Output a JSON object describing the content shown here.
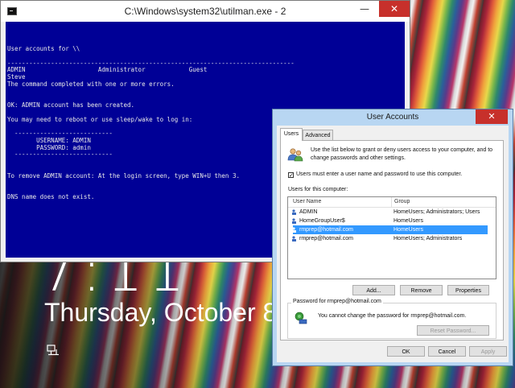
{
  "lockscreen": {
    "clock": "7:11",
    "date": "Thursday, October 8"
  },
  "console": {
    "title": "C:\\Windows\\system32\\utilman.exe - 2",
    "minimize_glyph": "—",
    "close_glyph": "✕",
    "lines": [
      "User accounts for \\\\",
      "",
      "-------------------------------------------------------------------------------",
      "ADMIN                    Administrator            Guest",
      "Steve",
      "The command completed with one or more errors.",
      "",
      "",
      "OK: ADMIN account has been created.",
      "",
      "You may need to reboot or use sleep/wake to log in:",
      "",
      "  ---------------------------",
      "        USERNAME: ADMIN",
      "        PASSWORD: admin",
      "  ---------------------------",
      "",
      "",
      "To remove ADMIN account: At the login screen, type WIN+U then 3.",
      "",
      "",
      "DNS name does not exist."
    ]
  },
  "dialog": {
    "title": "User Accounts",
    "close_glyph": "✕",
    "tabs": [
      "Users",
      "Advanced"
    ],
    "intro": "Use the list below to grant or deny users access to your computer, and to change passwords and other settings.",
    "require_password_checked": "✓",
    "require_password_label": "Users must enter a user name and password to use this computer.",
    "users_for_computer_label": "Users for this computer:",
    "columns": [
      "User Name",
      "Group"
    ],
    "users": [
      {
        "name": "ADMIN",
        "group": "HomeUsers; Administrators; Users"
      },
      {
        "name": "HomeGroupUser$",
        "group": "HomeUsers"
      },
      {
        "name": "rmprep@hotmail.com",
        "group": "HomeUsers"
      },
      {
        "name": "rmprep@hotmail.com",
        "group": "HomeUsers; Administrators"
      }
    ],
    "selected_index": 2,
    "buttons": {
      "add": "Add...",
      "remove": "Remove",
      "properties": "Properties"
    },
    "password_group_label": "Password for rmprep@hotmail.com",
    "password_text": "You cannot change the password for rmprep@hotmail.com.",
    "reset_password": "Reset Password...",
    "ok": "OK",
    "cancel": "Cancel",
    "apply": "Apply"
  },
  "colors": {
    "console_bg": "#000096",
    "selection": "#3399ff",
    "close_red": "#c7302b"
  }
}
